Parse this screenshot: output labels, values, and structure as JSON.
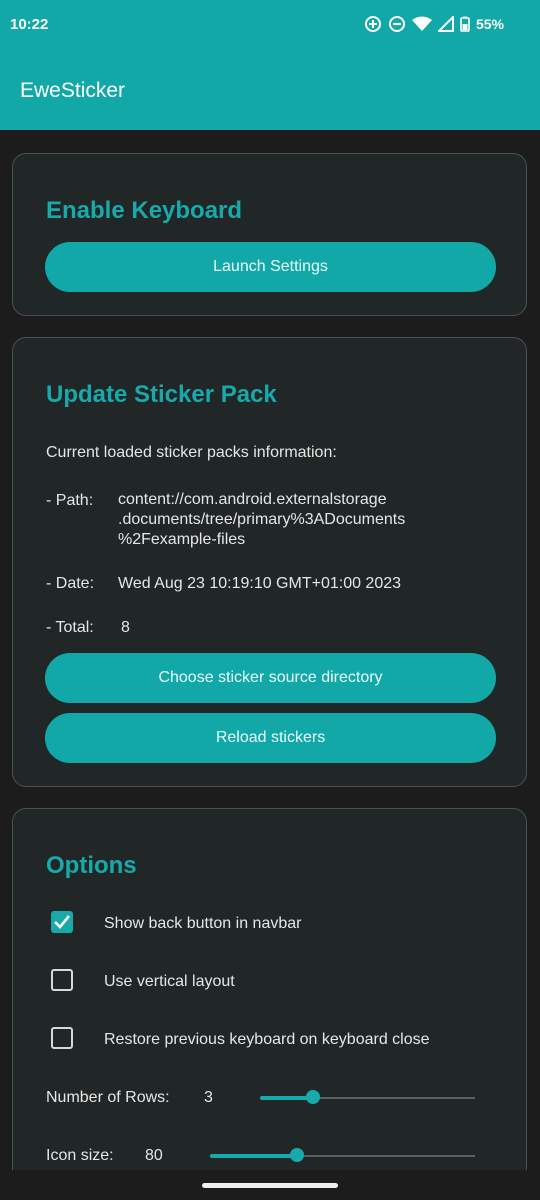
{
  "status": {
    "time": "10:22",
    "battery": "55%",
    "icons": [
      "data-saver-icon",
      "do-not-disturb-icon",
      "wifi-icon",
      "signal-icon",
      "battery-icon"
    ]
  },
  "app": {
    "title": "EweSticker"
  },
  "enable_card": {
    "title": "Enable Keyboard",
    "button": "Launch Settings"
  },
  "update_card": {
    "title": "Update Sticker Pack",
    "info_label": "Current loaded sticker packs information:",
    "path_label": "- Path:",
    "path_lines": [
      "content://com.android.externalstorage",
      ".documents/tree/primary%3ADocuments",
      "%2Fexample-files"
    ],
    "date_label": "- Date:",
    "date_value": "Wed Aug 23 10:19:10 GMT+01:00 2023",
    "total_label": "- Total:",
    "total_value": "8",
    "choose_button": "Choose sticker source directory",
    "reload_button": "Reload stickers"
  },
  "options_card": {
    "title": "Options",
    "checkboxes": [
      {
        "label": "Show back button in navbar",
        "checked": true
      },
      {
        "label": "Use vertical layout",
        "checked": false
      },
      {
        "label": "Restore previous keyboard on keyboard close",
        "checked": false
      }
    ],
    "rows_label": "Number of Rows:",
    "rows_value": "3",
    "icon_size_label": "Icon size:",
    "icon_size_value": "80"
  },
  "colors": {
    "accent": "#12a8a8",
    "card": "#212627",
    "background": "#1c1c1c"
  }
}
